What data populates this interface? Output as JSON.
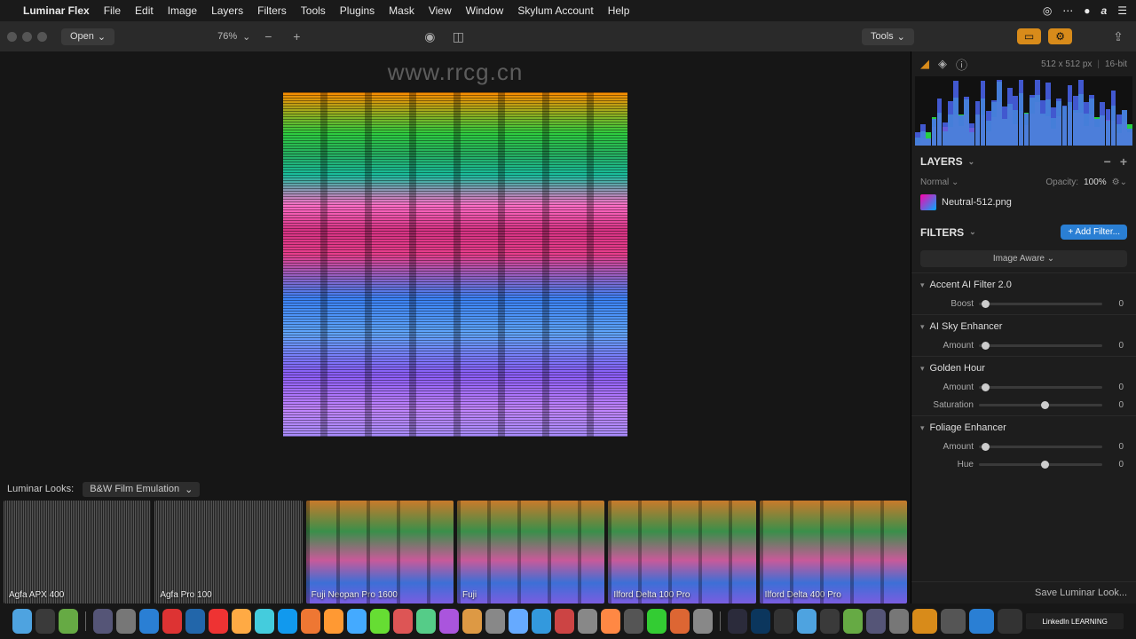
{
  "menubar": {
    "app": "Luminar Flex",
    "items": [
      "File",
      "Edit",
      "Image",
      "Layers",
      "Filters",
      "Tools",
      "Plugins",
      "Mask",
      "View",
      "Window",
      "Skylum Account",
      "Help"
    ]
  },
  "toolbar": {
    "open_label": "Open",
    "zoom": "76%",
    "tools_label": "Tools"
  },
  "watermark": "www.rrcg.cn",
  "info": {
    "dimensions": "512 x 512 px",
    "depth": "16-bit"
  },
  "layers": {
    "title": "LAYERS",
    "blend": "Normal",
    "opacity_label": "Opacity:",
    "opacity_value": "100%",
    "layer_name": "Neutral-512.png"
  },
  "filters": {
    "title": "FILTERS",
    "add_label": "+ Add Filter...",
    "image_aware": "Image Aware",
    "list": [
      {
        "name": "Accent AI Filter 2.0",
        "sliders": [
          {
            "label": "Boost",
            "pos": 2,
            "val": "0"
          }
        ]
      },
      {
        "name": "AI Sky Enhancer",
        "sliders": [
          {
            "label": "Amount",
            "pos": 2,
            "val": "0"
          }
        ]
      },
      {
        "name": "Golden Hour",
        "sliders": [
          {
            "label": "Amount",
            "pos": 2,
            "val": "0"
          },
          {
            "label": "Saturation",
            "pos": 50,
            "val": "0"
          }
        ]
      },
      {
        "name": "Foliage Enhancer",
        "sliders": [
          {
            "label": "Amount",
            "pos": 2,
            "val": "0"
          },
          {
            "label": "Hue",
            "pos": 50,
            "val": "0"
          }
        ]
      }
    ],
    "save_look": "Save Luminar Look..."
  },
  "looks": {
    "label": "Luminar Looks:",
    "category": "B&W Film Emulation",
    "items": [
      {
        "name": "Agfa APX 400",
        "bw": true
      },
      {
        "name": "Agfa Pro 100",
        "bw": true
      },
      {
        "name": "Fuji Neopan Pro 1600",
        "bw": false
      },
      {
        "name": "Fuji",
        "bw": false
      },
      {
        "name": "Ilford Delta 100 Pro",
        "bw": false
      },
      {
        "name": "Ilford Delta 400 Pro",
        "bw": false
      }
    ]
  },
  "histogram_heights": [
    5,
    12,
    8,
    30,
    55,
    20,
    45,
    70,
    38,
    60,
    22,
    48,
    72,
    30,
    58,
    90,
    44,
    66,
    52,
    78,
    40,
    62,
    85,
    50,
    70,
    35,
    60,
    48,
    72,
    55,
    80,
    42,
    65,
    30,
    50,
    38,
    60,
    25,
    45,
    18
  ],
  "dock_icons": 38,
  "linkedin": "LinkedIn LEARNING"
}
